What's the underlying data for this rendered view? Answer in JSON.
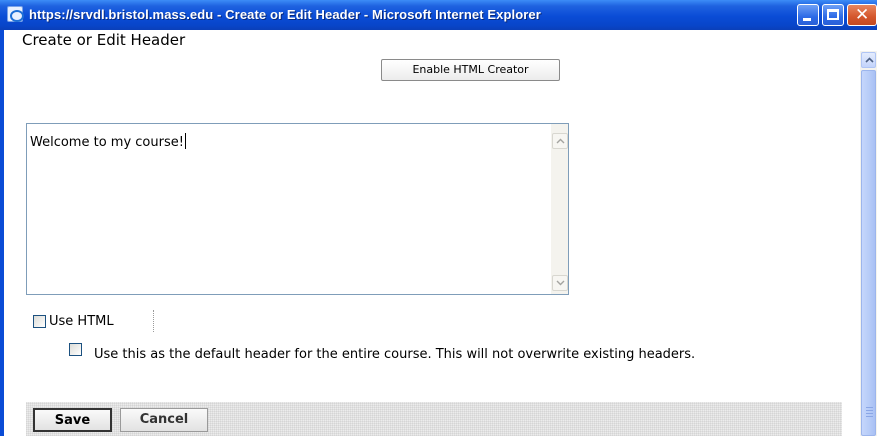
{
  "window": {
    "title": "https://srvdl.bristol.mass.edu - Create or Edit Header - Microsoft Internet Explorer",
    "close_glyph": "✕"
  },
  "page": {
    "heading": "Create or Edit Header",
    "enable_html_creator_label": "Enable HTML Creator",
    "editor": {
      "value": "Welcome to my course!"
    },
    "use_html": {
      "label": "Use HTML",
      "checked": false
    },
    "default_header": {
      "label": "Use this as the default header for the entire course. This will not overwrite existing headers.",
      "checked": false
    },
    "buttons": {
      "save_label": "Save",
      "cancel_label": "Cancel"
    }
  },
  "colors": {
    "titlebar": "#0a4cd6",
    "title_text": "#ffffff",
    "close_button": "#d4562c",
    "input_border": "#7f9db9",
    "checkbox_border": "#1c5180"
  },
  "icons": {
    "app": "ie-page-icon",
    "minimize": "minimize-icon",
    "maximize": "maximize-icon",
    "close": "close-icon",
    "scroll_up": "scroll-up-arrow-icon",
    "scroll_down": "scroll-down-arrow-icon"
  }
}
